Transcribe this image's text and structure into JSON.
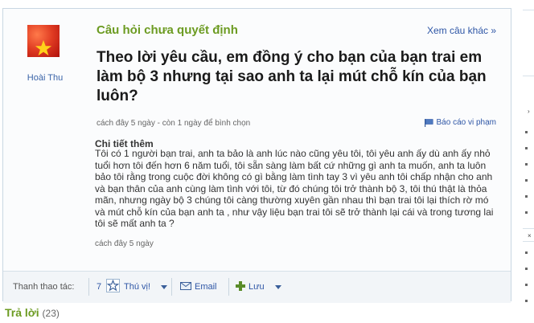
{
  "question": {
    "type_label": "Câu hỏi chưa quyết định",
    "more_link": "Xem câu khác »",
    "author": "Hoài Thu",
    "title": "Theo lời yêu cầu, em đồng ý cho bạn của bạn trai em làm bộ 3 nhưng tại sao anh ta lại mút chỗ kín của bạn luôn?",
    "meta": "cách đây 5 ngày - còn 1 ngày để bình chọn",
    "report_label": "Báo cáo vi phạm"
  },
  "details": {
    "heading": "Chi tiết thêm",
    "body": "Tôi có 1 người bạn trai, anh ta bảo là anh lúc nào cũng yêu tôi, tôi yêu anh ấy dù anh ấy nhỏ tuổi hơn tôi đến hơn 6 năm tuổi, tôi sẵn sàng làm bất cứ những gì anh ta muốn, anh ta luôn bảo tôi rằng trong cuộc đời không có gì bằng làm tình tay 3 vì yêu anh tôi chấp nhận cho anh và bạn thân của anh cùng làm tình với tôi, từ đó chúng tôi trở thành bộ 3, tôi thú thật là thỏa mãn, nhưng ngày bộ 3 chúng tôi càng thường xuyên gần nhau thì bạn trai tôi lại thích rờ mó và mút chỗ kín của bạn anh ta , như vậy liệu bạn trai tôi sẽ trở thành lại cái và trong tương lai tôi sẽ mất anh ta ?",
    "time": "cách đây 5 ngày"
  },
  "actions": {
    "label": "Thanh thao tác:",
    "star_count": "7",
    "favorite_label": "Thú vị!",
    "email_label": "Email",
    "save_label": "Lưu"
  },
  "answers": {
    "label": "Trả lời",
    "count": "(23)"
  },
  "colors": {
    "accent_green": "#6c9b22",
    "link_blue": "#2e56a6",
    "border": "#c9d7e3"
  },
  "icons": [
    "star-icon",
    "flag-icon",
    "email-icon",
    "save-icon",
    "caret-down-icon"
  ]
}
